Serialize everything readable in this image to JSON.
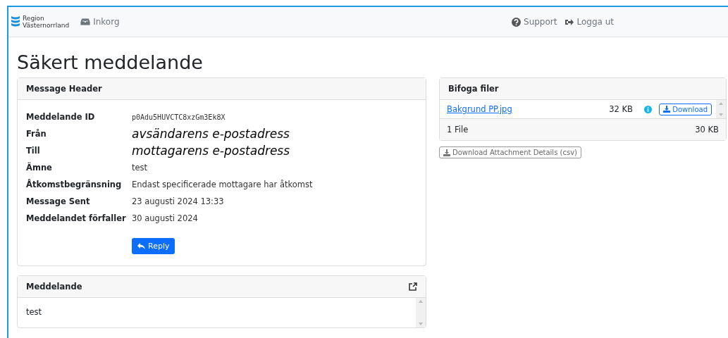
{
  "navbar": {
    "logo_lines": [
      "Region",
      "Västernorrland"
    ],
    "inbox": "Inkorg",
    "support": "Support",
    "logout": "Logga ut"
  },
  "page_title": "Säkert meddelande",
  "message_header": {
    "title": "Message Header",
    "fields": [
      {
        "label": "Meddelande ID",
        "value": "p0Adu5HUVCTC8xzGm3Ek8X",
        "kind": "mono"
      },
      {
        "label": "Från",
        "value": "avsändarens e-postadress",
        "kind": "large"
      },
      {
        "label": "Till",
        "value": "mottagarens e-postadress",
        "kind": "large"
      },
      {
        "label": "Ämne",
        "value": "test",
        "kind": "plain"
      },
      {
        "label": "Åtkomstbegränsning",
        "value": "Endast specificerade mottagare har åtkomst",
        "kind": "plain"
      },
      {
        "label": "Message Sent",
        "value": "23 augusti 2024 13:33",
        "kind": "plain"
      },
      {
        "label": "Meddelandet förfaller",
        "value": "30 augusti 2024",
        "kind": "plain"
      }
    ],
    "reply_button": "Reply"
  },
  "message": {
    "title": "Meddelande",
    "body": "test"
  },
  "attachments": {
    "title": "Bifoga filer",
    "files": [
      {
        "name": "Bakgrund PP.jpg",
        "size": "32 KB",
        "download": "Download"
      }
    ],
    "summary_count": "1 File",
    "summary_size": "30 KB",
    "details_button": "Download Attachment Details (csv)"
  }
}
